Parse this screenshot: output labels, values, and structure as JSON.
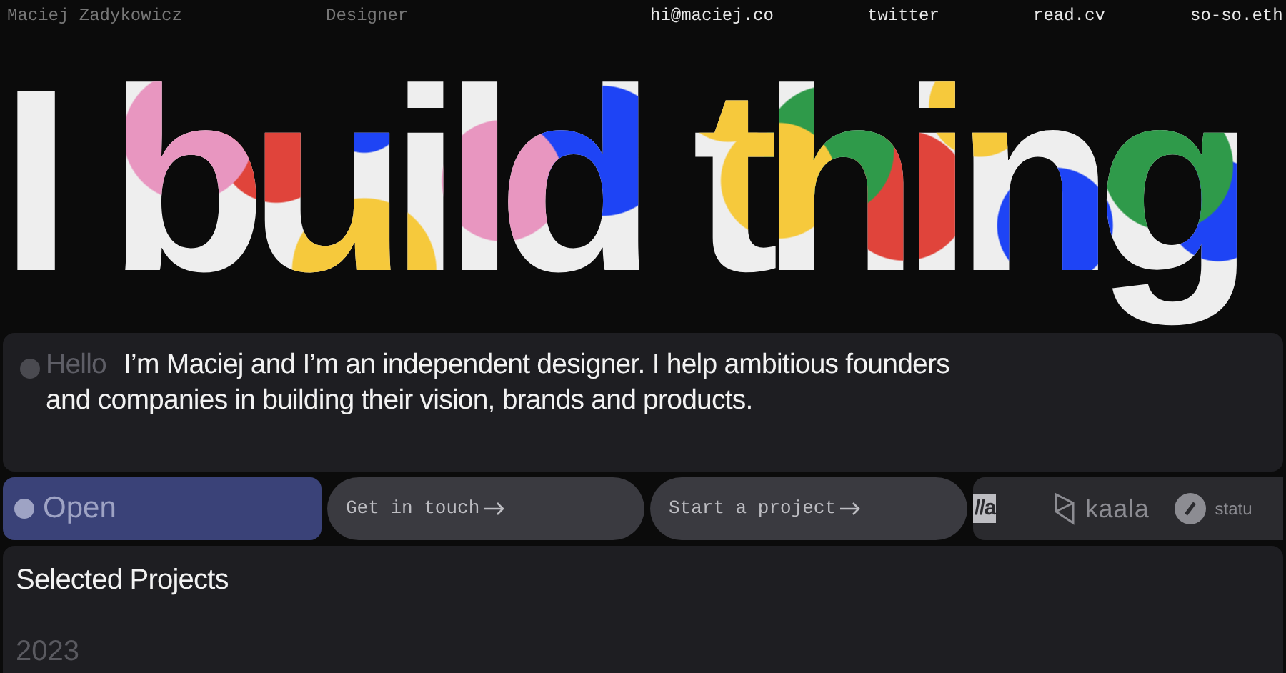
{
  "nav": [
    {
      "label": "Maciej Zadykowicz",
      "kind": "text"
    },
    {
      "label": "Designer",
      "kind": "text"
    },
    {
      "label": "hi@maciej.co",
      "kind": "link"
    },
    {
      "label": "twitter",
      "kind": "link"
    },
    {
      "label": "read.cv",
      "kind": "link"
    },
    {
      "label": "so-so.eth",
      "kind": "link"
    }
  ],
  "headline": "I build thing",
  "intro": {
    "greeting": "Hello",
    "text": "I’m Maciej and I’m an independent designer. I help ambitious founders and companies in building their vision, brands and products."
  },
  "status": {
    "label": "Open"
  },
  "buttons": [
    {
      "label": "Get in touch"
    },
    {
      "label": "Start a project"
    }
  ],
  "logos": [
    {
      "label": "//a",
      "kind": "box"
    },
    {
      "label": "kaala",
      "kind": "kaala"
    },
    {
      "label": "statu",
      "kind": "status"
    }
  ],
  "projects": {
    "title": "Selected Projects",
    "year": "2023"
  }
}
